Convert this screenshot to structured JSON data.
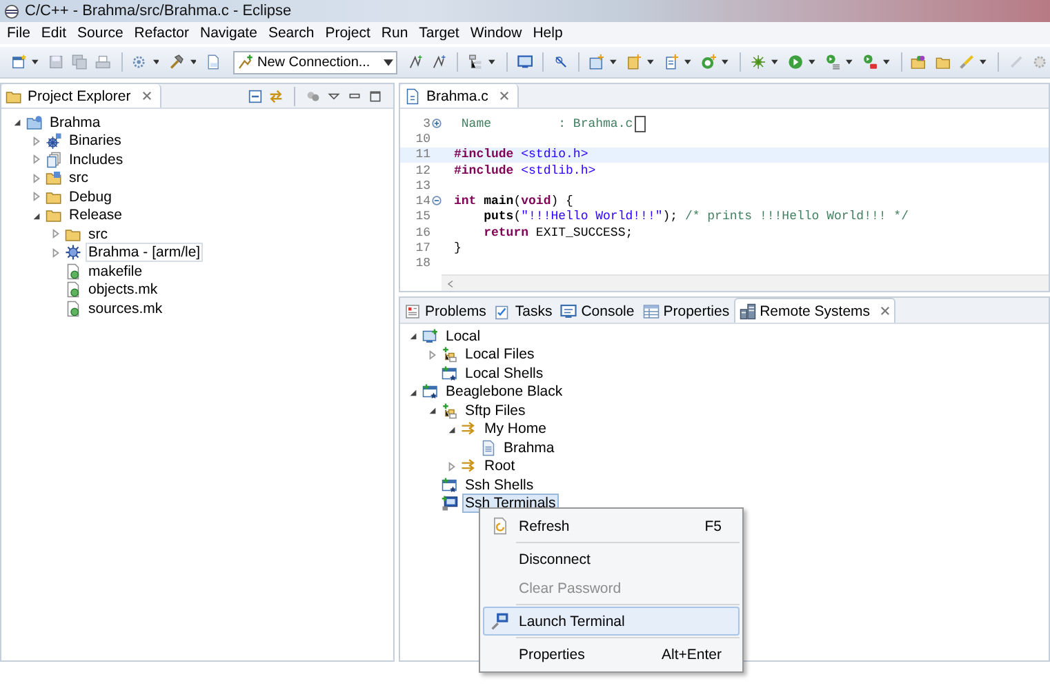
{
  "window": {
    "title": "C/C++ - Brahma/src/Brahma.c - Eclipse"
  },
  "menu_bar": [
    "File",
    "Edit",
    "Source",
    "Refactor",
    "Navigate",
    "Search",
    "Project",
    "Run",
    "Target",
    "Window",
    "Help"
  ],
  "toolbar": {
    "connection_combo": "New Connection..."
  },
  "project_explorer": {
    "title": "Project Explorer",
    "items": [
      {
        "label": "Brahma",
        "kind": "project",
        "expanded": true,
        "selected": false,
        "children": [
          {
            "label": "Binaries",
            "kind": "binaries",
            "expanded": false,
            "selected": false
          },
          {
            "label": "Includes",
            "kind": "includes",
            "expanded": false,
            "selected": false
          },
          {
            "label": "src",
            "kind": "source-folder",
            "expanded": false,
            "selected": false
          },
          {
            "label": "Debug",
            "kind": "folder",
            "expanded": false,
            "selected": false
          },
          {
            "label": "Release",
            "kind": "folder",
            "expanded": true,
            "selected": false,
            "children": [
              {
                "label": "src",
                "kind": "folder",
                "expanded": false,
                "selected": false
              },
              {
                "label": "Brahma - [arm/le]",
                "kind": "executable",
                "expanded": false,
                "selected": true
              },
              {
                "label": "makefile",
                "kind": "file",
                "selected": false
              },
              {
                "label": "objects.mk",
                "kind": "file",
                "selected": false
              },
              {
                "label": "sources.mk",
                "kind": "file",
                "selected": false
              }
            ]
          }
        ]
      }
    ]
  },
  "editor": {
    "tab": "Brahma.c",
    "lines": [
      {
        "number": "3",
        "folded": true,
        "current": false,
        "segments": [
          {
            "kind": "comment",
            "text": " Name         : Brahma.c"
          }
        ],
        "cursor": true
      },
      {
        "number": "10",
        "current": false
      },
      {
        "number": "11",
        "current": true,
        "segments": [
          {
            "kind": "keyword",
            "text": "#include"
          },
          {
            "kind": "header",
            "text": " <stdio.h>"
          }
        ]
      },
      {
        "number": "12",
        "current": false,
        "segments": [
          {
            "kind": "keyword",
            "text": "#include"
          },
          {
            "kind": "header",
            "text": " <stdlib.h>"
          }
        ]
      },
      {
        "number": "13",
        "current": false
      },
      {
        "number": "14",
        "folded": false,
        "current": false,
        "segments": [
          {
            "kind": "keyword",
            "text": "int"
          },
          {
            "kind": "function",
            "text": " main"
          },
          {
            "kind": "plain",
            "text": "("
          },
          {
            "kind": "keyword",
            "text": "void"
          },
          {
            "kind": "plain",
            "text": ") {"
          }
        ]
      },
      {
        "number": "15",
        "current": false,
        "segments": [
          {
            "kind": "function",
            "text": "    puts"
          },
          {
            "kind": "plain",
            "text": "("
          },
          {
            "kind": "string",
            "text": "\"!!!Hello World!!!\""
          },
          {
            "kind": "plain",
            "text": "); "
          },
          {
            "kind": "comment",
            "text": "/* prints !!!Hello World!!! */"
          }
        ]
      },
      {
        "number": "16",
        "current": false,
        "segments": [
          {
            "kind": "keyword",
            "text": "    return"
          },
          {
            "kind": "plain",
            "text": " EXIT_SUCCESS;"
          }
        ]
      },
      {
        "number": "17",
        "current": false,
        "segments": [
          {
            "kind": "plain",
            "text": "}"
          }
        ]
      },
      {
        "number": "18",
        "current": false
      }
    ]
  },
  "bottom_panel": {
    "tabs": [
      {
        "label": "Problems",
        "kind": "problems",
        "selected": false
      },
      {
        "label": "Tasks",
        "kind": "tasks",
        "selected": false
      },
      {
        "label": "Console",
        "kind": "console",
        "selected": false
      },
      {
        "label": "Properties",
        "kind": "properties",
        "selected": false
      },
      {
        "label": "Remote Systems",
        "kind": "remote",
        "selected": true
      }
    ],
    "remote_tree": [
      {
        "label": "Local",
        "kind": "computer",
        "expanded": true,
        "selected": false,
        "children": [
          {
            "label": "Local Files",
            "kind": "files",
            "expanded": false,
            "selected": false
          },
          {
            "label": "Local Shells",
            "kind": "shells",
            "selected": false
          }
        ]
      },
      {
        "label": "Beaglebone Black",
        "kind": "shells",
        "expanded": true,
        "selected": false,
        "children": [
          {
            "label": "Sftp Files",
            "kind": "files",
            "expanded": true,
            "selected": false,
            "children": [
              {
                "label": "My Home",
                "kind": "arrows",
                "expanded": true,
                "selected": false,
                "children": [
                  {
                    "label": "Brahma",
                    "kind": "document",
                    "selected": false
                  }
                ]
              },
              {
                "label": "Root",
                "kind": "arrows",
                "expanded": false,
                "selected": false
              }
            ]
          },
          {
            "label": "Ssh Shells",
            "kind": "shells",
            "selected": false
          },
          {
            "label": "Ssh Terminals",
            "kind": "terminal",
            "selected": true
          }
        ]
      }
    ]
  },
  "context_menu": [
    {
      "kind": "refresh",
      "label": "Refresh",
      "shortcut": "F5",
      "disabled": false,
      "selected": false
    },
    {
      "kind": "separator"
    },
    {
      "kind": "plain",
      "label": "Disconnect",
      "disabled": false,
      "selected": false
    },
    {
      "kind": "plain",
      "label": "Clear Password",
      "disabled": true,
      "selected": false
    },
    {
      "kind": "separator"
    },
    {
      "kind": "terminal",
      "label": "Launch Terminal",
      "disabled": false,
      "selected": true
    },
    {
      "kind": "separator"
    },
    {
      "kind": "plain",
      "label": "Properties",
      "shortcut": "Alt+Enter",
      "disabled": false,
      "selected": false
    }
  ]
}
